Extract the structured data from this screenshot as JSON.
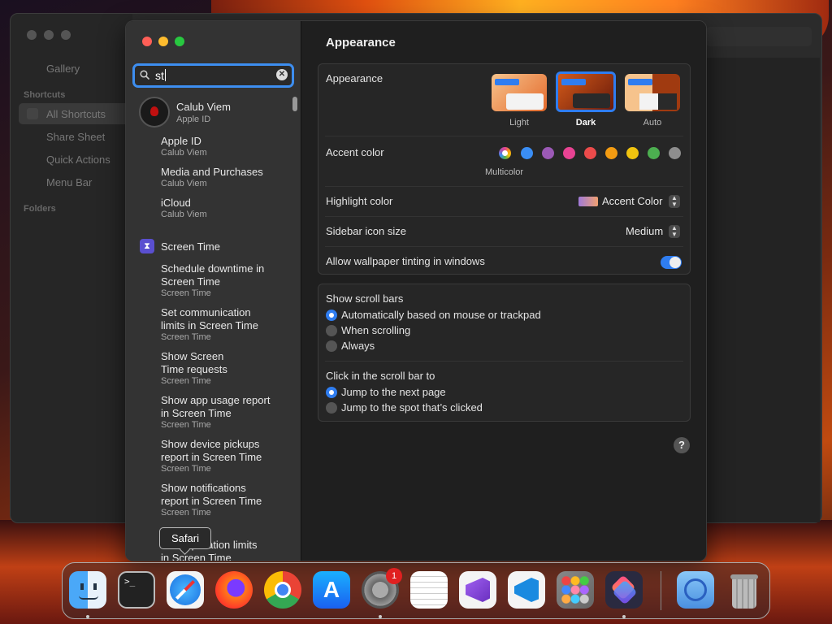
{
  "background_window": {
    "items": [
      "Gallery",
      "All Shortcuts",
      "Share Sheet",
      "Quick Actions",
      "Menu Bar"
    ],
    "headers": [
      "Shortcuts",
      "Folders"
    ]
  },
  "sidebar": {
    "search_value": "st",
    "account": {
      "name": "Calub Viem",
      "sub": "Apple ID"
    },
    "results": [
      {
        "title": "Apple ID",
        "sub": "Calub Viem"
      },
      {
        "title": "Media and Purchases",
        "sub": "Calub Viem"
      },
      {
        "title": "iCloud",
        "sub": "Calub Viem"
      }
    ],
    "section": "Screen Time",
    "screen_time_results": [
      {
        "l1": "Schedule downtime in",
        "l2": "Screen Time",
        "sub": "Screen Time"
      },
      {
        "l1": "Set communication",
        "l2": "limits in Screen Time",
        "sub": "Screen Time"
      },
      {
        "l1": "Show Screen",
        "l2": "Time requests",
        "sub": "Screen Time"
      },
      {
        "l1": "Show app usage report",
        "l2": "in Screen Time",
        "sub": "Screen Time"
      },
      {
        "l1": "Show device pickups",
        "l2": "report in Screen Time",
        "sub": "Screen Time"
      },
      {
        "l1": "Show notifications",
        "l2": "report in Screen Time",
        "sub": "Screen Time"
      },
      {
        "l1": "Set application limits",
        "l2": "in Screen Time",
        "sub": ""
      }
    ],
    "tooltip": "Safari"
  },
  "content": {
    "title": "Appearance",
    "appearance": {
      "label": "Appearance",
      "options": [
        "Light",
        "Dark",
        "Auto"
      ],
      "selected": "Dark"
    },
    "accent": {
      "label": "Accent color",
      "selected_caption": "Multicolor",
      "colors": [
        "#3a8ef5",
        "#9b59b6",
        "#e84393",
        "#ec4b4b",
        "#f39c12",
        "#f1c40f",
        "#4caf50",
        "#8e8e8e"
      ]
    },
    "highlight": {
      "label": "Highlight color",
      "value": "Accent Color"
    },
    "icon_size": {
      "label": "Sidebar icon size",
      "value": "Medium"
    },
    "tinting": {
      "label": "Allow wallpaper tinting in windows",
      "enabled": true
    },
    "scroll_bars": {
      "label": "Show scroll bars",
      "options": [
        "Automatically based on mouse or trackpad",
        "When scrolling",
        "Always"
      ],
      "selected": 0
    },
    "click_scroll": {
      "label": "Click in the scroll bar to",
      "options": [
        "Jump to the next page",
        "Jump to the spot that’s clicked"
      ],
      "selected": 0
    },
    "help": "?"
  },
  "dock": {
    "apps": [
      "finder-icon",
      "terminal-icon",
      "safari-icon",
      "firefox-icon",
      "chrome-icon",
      "app-store-icon",
      "system-settings-icon",
      "textedit-icon",
      "visual-studio-icon",
      "vscode-icon",
      "launchpad-icon",
      "shortcuts-icon",
      "downloads-folder-icon",
      "trash-icon"
    ],
    "settings_badge": "1",
    "terminal_prompt": ">_"
  }
}
